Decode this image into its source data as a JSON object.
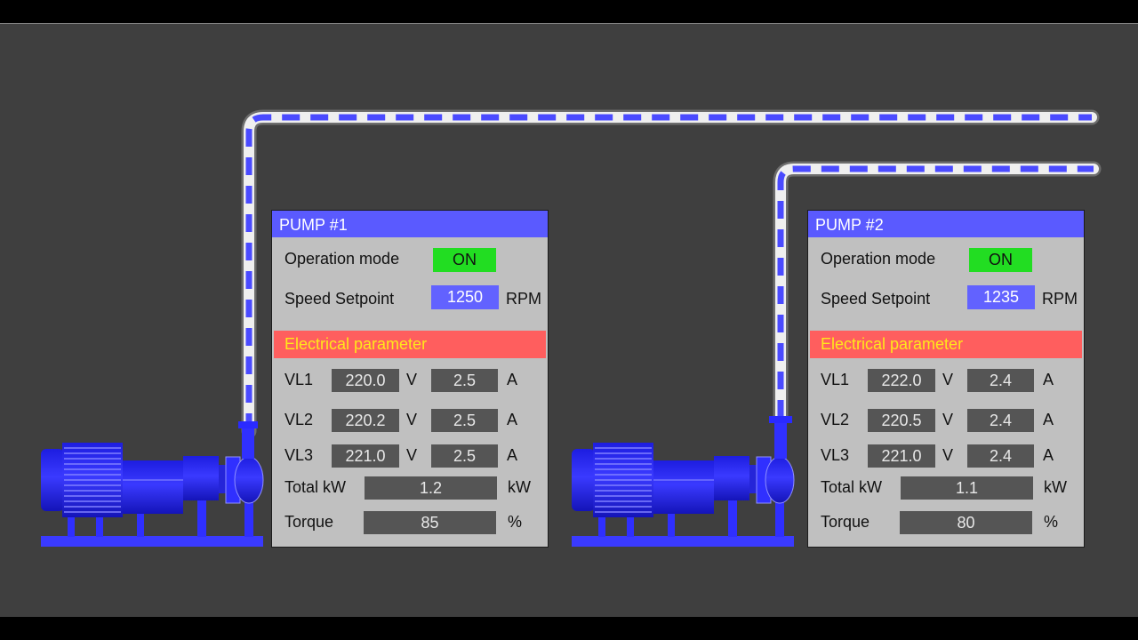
{
  "pump1": {
    "title": "PUMP #1",
    "operation_mode_label": "Operation mode",
    "operation_mode_value": "ON",
    "speed_setpoint_label": "Speed Setpoint",
    "speed_setpoint_value": "1250",
    "speed_unit": "RPM",
    "electrical_header": "Electrical parameter",
    "phases": [
      {
        "label": "VL1",
        "voltage": "220.0",
        "voltage_unit": "V",
        "current": "2.5",
        "current_unit": "A"
      },
      {
        "label": "VL2",
        "voltage": "220.2",
        "voltage_unit": "V",
        "current": "2.5",
        "current_unit": "A"
      },
      {
        "label": "VL3",
        "voltage": "221.0",
        "voltage_unit": "V",
        "current": "2.5",
        "current_unit": "A"
      }
    ],
    "total_kw_label": "Total kW",
    "total_kw_value": "1.2",
    "total_kw_unit": "kW",
    "torque_label": "Torque",
    "torque_value": "85",
    "torque_unit": "%"
  },
  "pump2": {
    "title": "PUMP #2",
    "operation_mode_label": "Operation mode",
    "operation_mode_value": "ON",
    "speed_setpoint_label": "Speed Setpoint",
    "speed_setpoint_value": "1235",
    "speed_unit": "RPM",
    "electrical_header": "Electrical parameter",
    "phases": [
      {
        "label": "VL1",
        "voltage": "222.0",
        "voltage_unit": "V",
        "current": "2.4",
        "current_unit": "A"
      },
      {
        "label": "VL2",
        "voltage": "220.5",
        "voltage_unit": "V",
        "current": "2.4",
        "current_unit": "A"
      },
      {
        "label": "VL3",
        "voltage": "221.0",
        "voltage_unit": "V",
        "current": "2.4",
        "current_unit": "A"
      }
    ],
    "total_kw_label": "Total kW",
    "total_kw_value": "1.1",
    "total_kw_unit": "kW",
    "torque_label": "Torque",
    "torque_value": "80",
    "torque_unit": "%"
  },
  "colors": {
    "background": "#3f3f3f",
    "panel": "#c0c0c0",
    "header_blue": "#5a5aff",
    "status_on": "#22dd22",
    "setpoint_blue": "#6262ff",
    "electrical_header": "#ff5e5e",
    "electrical_text": "#ffe81a",
    "value_box": "#555555",
    "pump_blue": "#2b2bff",
    "flow_blue": "#4a4aff"
  },
  "icons": [
    "pump-motor-icon",
    "pipe-flow-icon"
  ]
}
